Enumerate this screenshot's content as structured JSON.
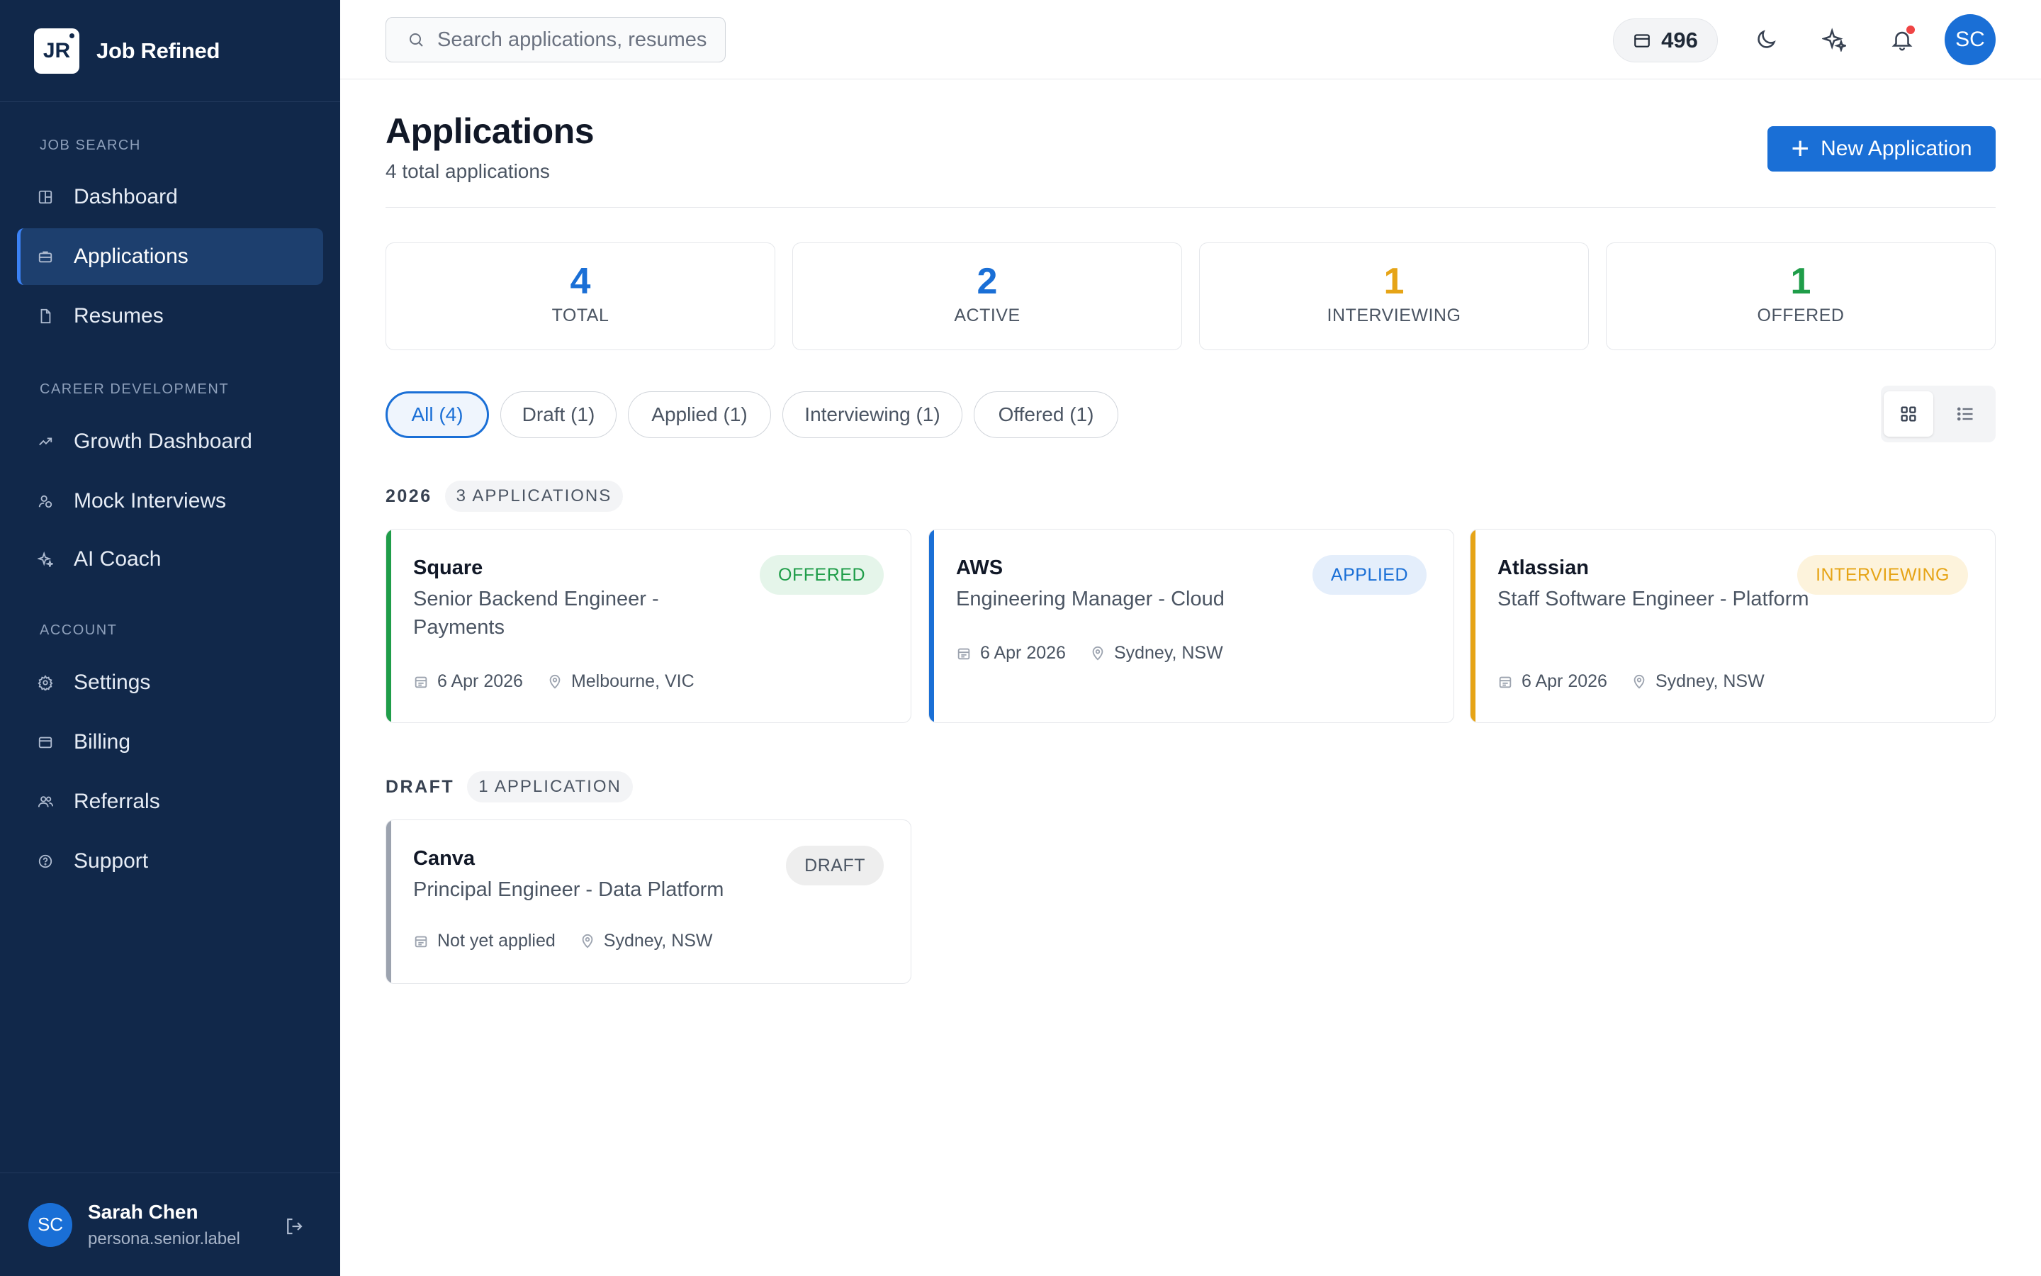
{
  "app": {
    "logo_text": "JR",
    "name": "Job Refined"
  },
  "sidebar": {
    "sections": [
      {
        "title": "JOB SEARCH",
        "items": [
          {
            "label": "Dashboard",
            "icon": "dashboard-icon"
          },
          {
            "label": "Applications",
            "icon": "briefcase-icon",
            "active": true
          },
          {
            "label": "Resumes",
            "icon": "file-icon"
          }
        ]
      },
      {
        "title": "CAREER DEVELOPMENT",
        "items": [
          {
            "label": "Growth Dashboard",
            "icon": "trending-up-icon"
          },
          {
            "label": "Mock Interviews",
            "icon": "users-icon"
          },
          {
            "label": "AI Coach",
            "icon": "sparkles-icon"
          }
        ]
      },
      {
        "title": "ACCOUNT",
        "items": [
          {
            "label": "Settings",
            "icon": "gear-icon"
          },
          {
            "label": "Billing",
            "icon": "wallet-icon"
          },
          {
            "label": "Referrals",
            "icon": "people-icon"
          },
          {
            "label": "Support",
            "icon": "help-icon"
          }
        ]
      }
    ],
    "user": {
      "initials": "SC",
      "name": "Sarah Chen",
      "role": "persona.senior.label"
    }
  },
  "topbar": {
    "search_placeholder": "Search applications, resumes...",
    "credits": "496",
    "avatar_initials": "SC",
    "icons": [
      "wallet-icon",
      "moon-icon",
      "sparkles-icon",
      "bell-icon"
    ]
  },
  "page": {
    "title": "Applications",
    "subtitle": "4 total applications",
    "new_button": "New Application"
  },
  "stats": [
    {
      "value": "4",
      "label": "TOTAL",
      "color": "#1a6fd6"
    },
    {
      "value": "2",
      "label": "ACTIVE",
      "color": "#1a6fd6"
    },
    {
      "value": "1",
      "label": "INTERVIEWING",
      "color": "#e6a416"
    },
    {
      "value": "1",
      "label": "OFFERED",
      "color": "#1f9d49"
    }
  ],
  "filters": [
    {
      "label": "All (4)",
      "active": true
    },
    {
      "label": "Draft (1)"
    },
    {
      "label": "Applied (1)"
    },
    {
      "label": "Interviewing (1)"
    },
    {
      "label": "Offered (1)"
    }
  ],
  "view_toggle": {
    "selected": "grid"
  },
  "groups": [
    {
      "title": "2026",
      "count": "3 APPLICATIONS",
      "cards": [
        {
          "company": "Square",
          "role": "Senior Backend Engineer - Payments",
          "status": "OFFERED",
          "status_color": "#1f9d49",
          "status_bg": "#e5f5ea",
          "bar_color": "#1f9d49",
          "date": "6 Apr 2026",
          "location": "Melbourne, VIC"
        },
        {
          "company": "AWS",
          "role": "Engineering Manager - Cloud",
          "status": "APPLIED",
          "status_color": "#1a6fd6",
          "status_bg": "#e4eefb",
          "bar_color": "#1a6fd6",
          "date": "6 Apr 2026",
          "location": "Sydney, NSW"
        },
        {
          "company": "Atlassian",
          "role": "Staff Software Engineer - Platform",
          "status": "INTERVIEWING",
          "status_color": "#e6a416",
          "status_bg": "#fdf3dc",
          "bar_color": "#e6a416",
          "date": "6 Apr 2026",
          "location": "Sydney, NSW"
        }
      ]
    },
    {
      "title": "DRAFT",
      "count": "1 APPLICATION",
      "cards": [
        {
          "company": "Canva",
          "role": "Principal Engineer - Data Platform",
          "status": "DRAFT",
          "status_color": "#4b5563",
          "status_bg": "#eeeeee",
          "bar_color": "#9ca3af",
          "date": "Not yet applied",
          "location": "Sydney, NSW"
        }
      ]
    }
  ]
}
